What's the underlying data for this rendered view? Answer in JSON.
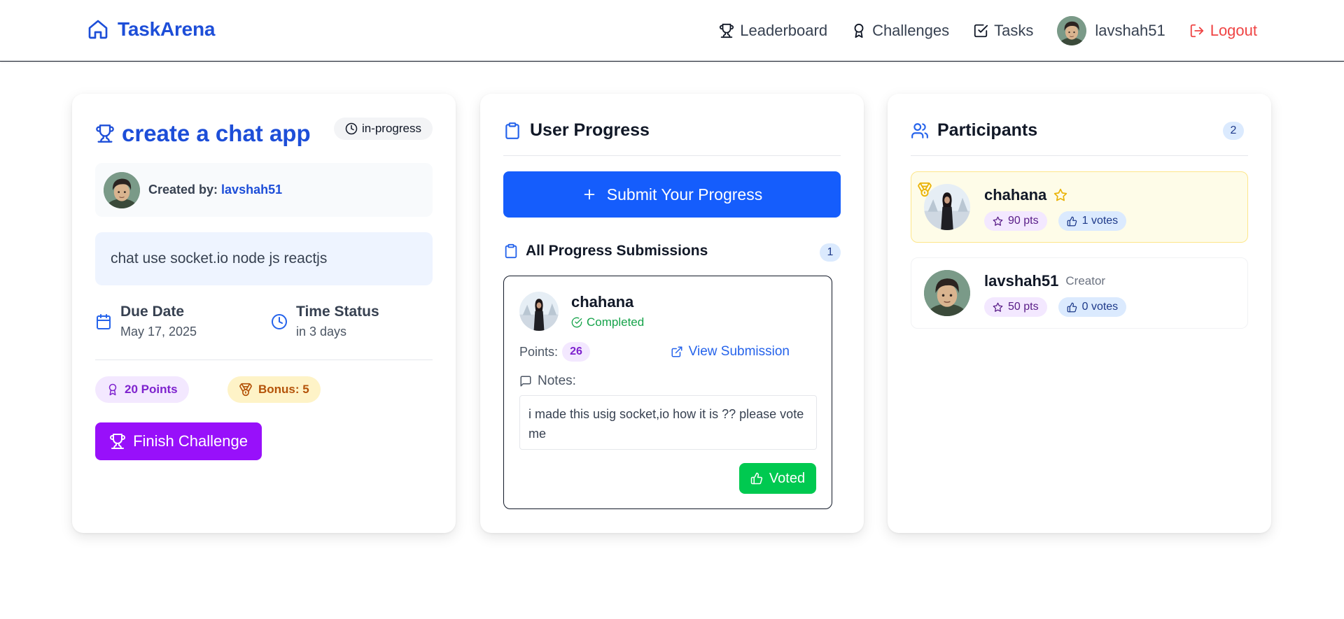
{
  "colors": {
    "brand": "#1d4ed8",
    "primary_button": "#155dfc",
    "finish_button": "#9810fa",
    "voted_button": "#00c950",
    "logout": "#ef4444",
    "completed": "#16a34a"
  },
  "navbar": {
    "brand": "TaskArena",
    "brand_icon": "home-icon",
    "links": [
      {
        "label": "Leaderboard",
        "icon": "trophy-icon"
      },
      {
        "label": "Challenges",
        "icon": "award-icon"
      },
      {
        "label": "Tasks",
        "icon": "check-square-icon"
      }
    ],
    "username": "lavshah51",
    "logout": "Logout"
  },
  "challenge": {
    "title": "create a chat app",
    "status": "in-progress",
    "created_by_label": "Created by:",
    "created_by": "lavshah51",
    "description": "chat use socket.io node js reactjs",
    "due_date_label": "Due Date",
    "due_date": "May 17, 2025",
    "time_status_label": "Time Status",
    "time_status": "in 3 days",
    "points": "20 Points",
    "bonus": "Bonus: 5",
    "finish_button": "Finish Challenge"
  },
  "progress": {
    "title": "User Progress",
    "submit_button": "Submit Your Progress",
    "submissions_title": "All Progress Submissions",
    "submissions_count": "1",
    "submissions": [
      {
        "name": "chahana",
        "status": "Completed",
        "points_label": "Points:",
        "points": "26",
        "view_link": "View Submission",
        "notes_label": "Notes:",
        "notes": "i made this usig socket,io how it is ?? please vote me",
        "vote_button": "Voted"
      }
    ]
  },
  "participants": {
    "title": "Participants",
    "count": "2",
    "items": [
      {
        "name": "chahana",
        "tag": "",
        "points": "90 pts",
        "votes": "1 votes"
      },
      {
        "name": "lavshah51",
        "tag": "Creator",
        "points": "50 pts",
        "votes": "0 votes"
      }
    ]
  }
}
